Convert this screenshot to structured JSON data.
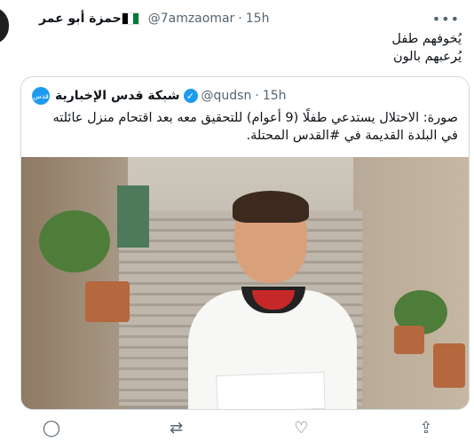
{
  "tweet": {
    "display_name": "حمزة أبو عمر",
    "handle": "@7amzaomar",
    "separator": "·",
    "time": "15h",
    "flag_colors": [
      "#000000",
      "#ffffff",
      "#007a3d",
      "#ce1126"
    ],
    "lines": [
      "يُخوفهم طفل",
      "يُرعبهم بالون"
    ]
  },
  "quote": {
    "avatar_label": "قدس",
    "display_name": "شبكة قدس الإخبارية",
    "verified_icon": "✓",
    "handle": "@qudsn",
    "separator": "·",
    "time": "15h",
    "text": "صورة: الاحتلال يستدعي طفلًا (9 أعوام) للتحقيق معه بعد اقتحام منزل عائلته في البلدة القديمة في #القدس المحتلة."
  },
  "icons": {
    "more": "•••",
    "reply": "◯",
    "retweet": "⇄",
    "like": "♡",
    "share": "⇪"
  },
  "accent": "#1d9bf0"
}
